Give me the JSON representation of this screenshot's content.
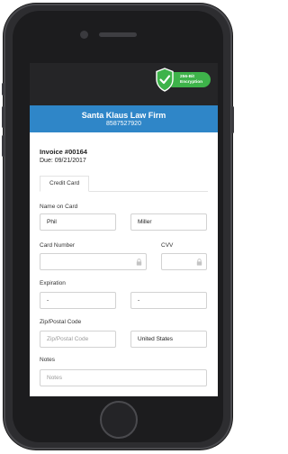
{
  "badge": {
    "line1": "256-Bit",
    "line2": "Encryption",
    "icon": "shield-check-icon",
    "color": "#3eb34a"
  },
  "header": {
    "firm": "Santa Klaus Law Firm",
    "phone": "8587527920",
    "color": "#2f86c8"
  },
  "invoice": {
    "number": "Invoice #00164",
    "due": "Due: 09/21/2017"
  },
  "tabs": [
    {
      "label": "Credit Card"
    }
  ],
  "form": {
    "name_label": "Name on Card",
    "first_name": "Phil",
    "last_name": "Miller",
    "card_number_label": "Card Number",
    "cvv_label": "CVV",
    "expiration_label": "Expiration",
    "exp_month": "-",
    "exp_year": "-",
    "zip_label": "Zip/Postal Code",
    "zip_placeholder": "Zip/Postal Code",
    "country": "United States",
    "notes_label": "Notes",
    "notes_placeholder": "Notes"
  }
}
